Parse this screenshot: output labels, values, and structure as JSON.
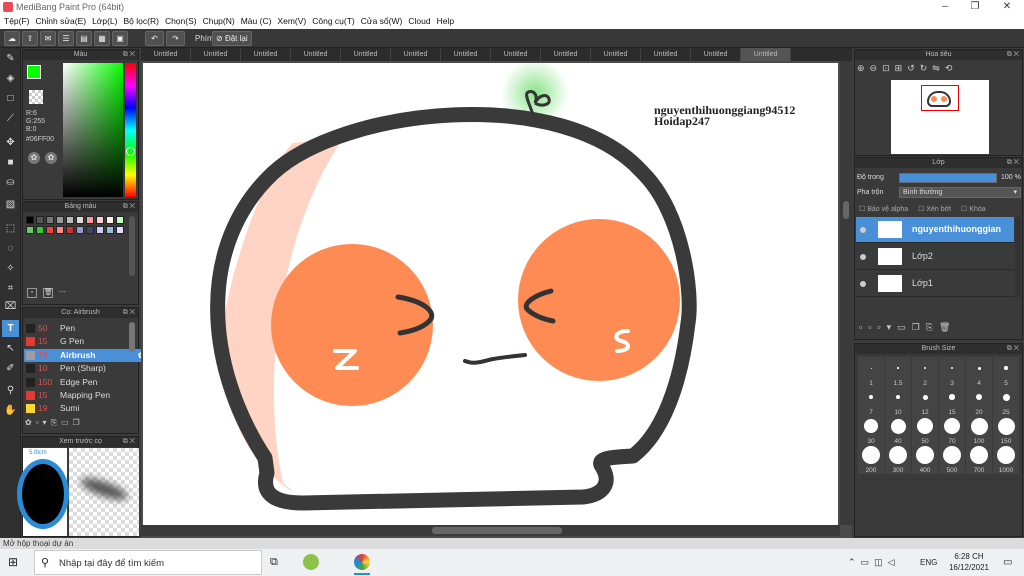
{
  "window": {
    "title": "MediBang Paint Pro (64bit)"
  },
  "menu": [
    "Tệp(F)",
    "Chỉnh sửa(E)",
    "Lớp(L)",
    "Bộ lọc(R)",
    "Chọn(S)",
    "Chụp(N)",
    "Màu (C)",
    "Xem(V)",
    "Công cụ(T)",
    "Cửa sổ(W)",
    "Cloud",
    "Help"
  ],
  "toolbar": {
    "hotkey_label": "Phím",
    "reset_label": "Đặt lại"
  },
  "color_panel": {
    "title": "Màu",
    "r": "R:6",
    "g": "G:255",
    "b": "B:0",
    "hex": "#06FF00",
    "fg": "#06FF00"
  },
  "palette_panel": {
    "title": "Bảng màu",
    "footer": "---"
  },
  "brush_panel": {
    "title": "Cọ: Airbrush",
    "items": [
      {
        "size": "50",
        "name": "Pen",
        "color": "#222222"
      },
      {
        "size": "15",
        "name": "G Pen",
        "color": "#e53935"
      },
      {
        "size": "70",
        "name": "Airbrush",
        "color": "#9e9e9e",
        "selected": true
      },
      {
        "size": "10",
        "name": "Pen (Sharp)",
        "color": "#222222"
      },
      {
        "size": "150",
        "name": "Edge Pen",
        "color": "#222222"
      },
      {
        "size": "15",
        "name": "Mapping Pen",
        "color": "#e53935"
      },
      {
        "size": "19",
        "name": "Sumi",
        "color": "#fdd835"
      }
    ]
  },
  "preview_panel": {
    "title": "Xem trước cọ",
    "label": "5.0lcm"
  },
  "tabs": [
    "Untitled",
    "Untitled",
    "Untitled",
    "Untitled",
    "Untitled",
    "Untitled",
    "Untitled",
    "Untitled",
    "Untitled",
    "Untitled",
    "Untitled",
    "Untitled",
    "Untitled"
  ],
  "canvas": {
    "watermark_line1": "nguyenthihuonggiang94512",
    "watermark_line2": "Hoidap247"
  },
  "navigator": {
    "title": "Hoa tiêu"
  },
  "layer_panel": {
    "title": "Lớp",
    "opacity_label": "Độ trong",
    "opacity_value": "100 %",
    "blend_label": "Pha trộn",
    "blend_value": "Bình thường",
    "protect_alpha": "Bảo vệ alpha",
    "clip": "Xén bớt",
    "lock": "Khóa",
    "layers": [
      {
        "name": "nguyenthihuonggian",
        "selected": true
      },
      {
        "name": "Lớp2"
      },
      {
        "name": "Lớp1"
      }
    ]
  },
  "brush_size": {
    "title": "Brush Size",
    "sizes": [
      "1",
      "1.5",
      "2",
      "3",
      "4",
      "5",
      "7",
      "10",
      "12",
      "15",
      "20",
      "25",
      "30",
      "40",
      "50",
      "70",
      "100",
      "150",
      "200",
      "300",
      "400",
      "500",
      "700",
      "1000"
    ]
  },
  "status": {
    "text": "Mở hộp thoại dự án"
  },
  "taskbar": {
    "search_placeholder": "Nhập tại đây để tìm kiếm",
    "time": "6:28 CH",
    "date": "16/12/2021",
    "lang": "ENG"
  }
}
